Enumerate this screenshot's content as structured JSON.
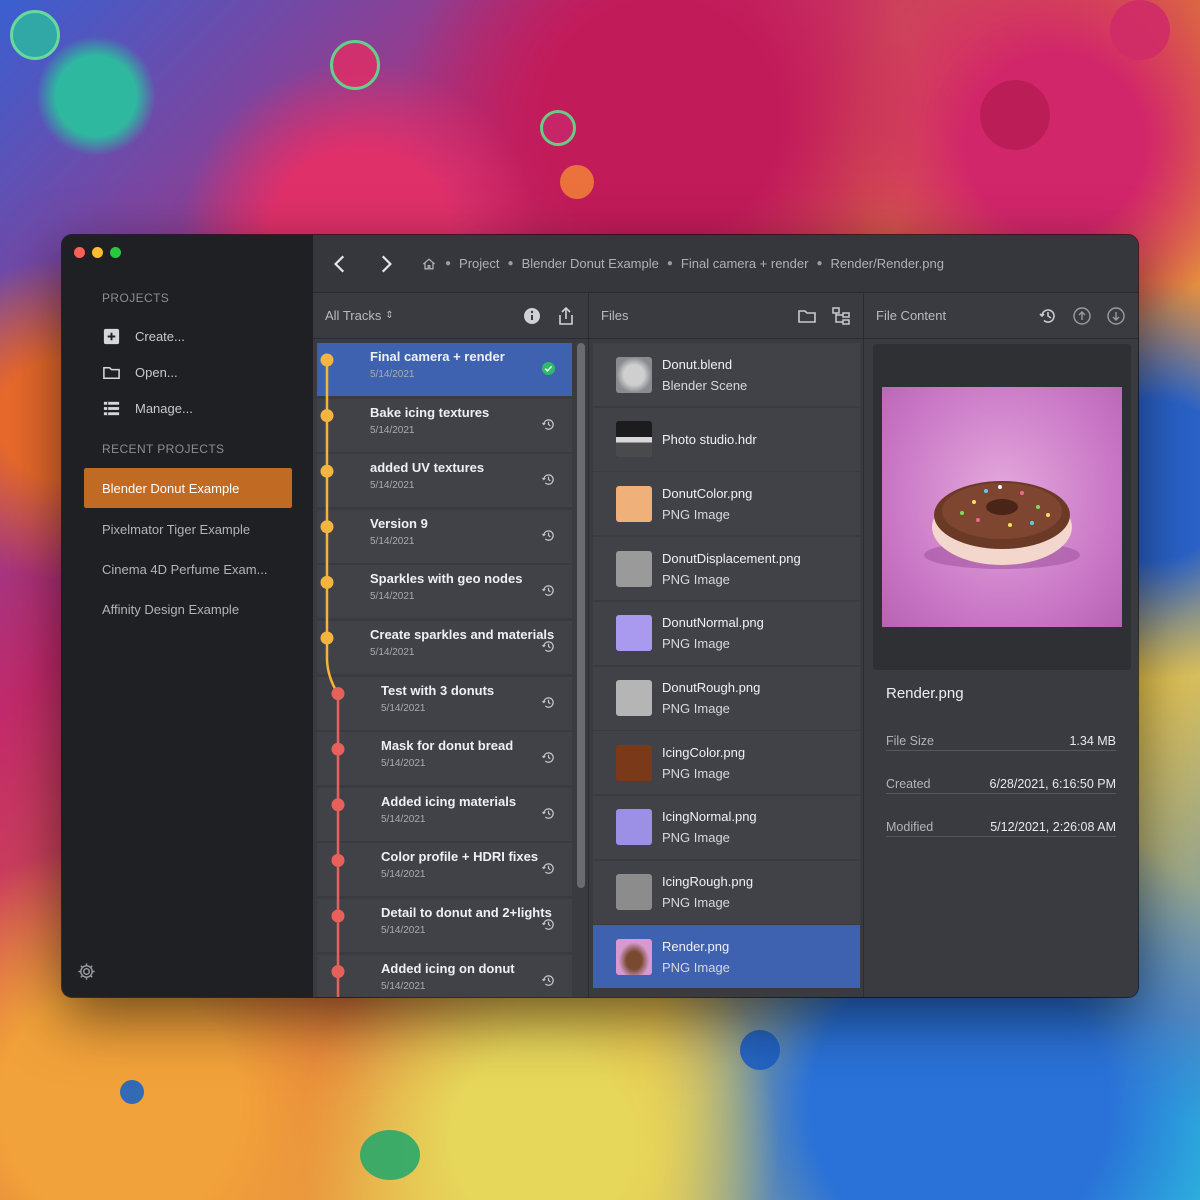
{
  "sidebar": {
    "projects_title": "PROJECTS",
    "actions": [
      {
        "label": "Create...",
        "icon": "plus-square-icon"
      },
      {
        "label": "Open...",
        "icon": "folder-icon"
      },
      {
        "label": "Manage...",
        "icon": "list-icon"
      }
    ],
    "recent_title": "RECENT PROJECTS",
    "recent": [
      {
        "label": "Blender Donut Example",
        "active": true
      },
      {
        "label": "Pixelmator Tiger Example",
        "active": false
      },
      {
        "label": "Cinema 4D Perfume Exam...",
        "active": false
      },
      {
        "label": "Affinity Design Example",
        "active": false
      }
    ],
    "accent": "#c06a24"
  },
  "breadcrumb": [
    "Project",
    "Blender Donut Example",
    "Final camera + render",
    "Render/Render.png"
  ],
  "tracks": {
    "header": "All Tracks",
    "items": [
      {
        "title": "Final camera + render",
        "date": "5/14/2021",
        "branch": "yellow",
        "active": true,
        "icon": "check-circle-icon"
      },
      {
        "title": "Bake icing textures",
        "date": "5/14/2021",
        "branch": "yellow",
        "icon": "history-icon"
      },
      {
        "title": "added UV textures",
        "date": "5/14/2021",
        "branch": "yellow",
        "icon": "history-icon"
      },
      {
        "title": "Version 9",
        "date": "5/14/2021",
        "branch": "yellow",
        "icon": "history-icon"
      },
      {
        "title": "Sparkles with geo nodes",
        "date": "5/14/2021",
        "branch": "yellow",
        "icon": "history-icon"
      },
      {
        "title": "Create sparkles and materials",
        "date": "5/14/2021",
        "branch": "yellow",
        "icon": "history-icon"
      },
      {
        "title": "Test with 3 donuts",
        "date": "5/14/2021",
        "branch": "red",
        "icon": "history-icon"
      },
      {
        "title": "Mask for donut bread",
        "date": "5/14/2021",
        "branch": "red",
        "icon": "history-icon"
      },
      {
        "title": "Added icing materials",
        "date": "5/14/2021",
        "branch": "red",
        "icon": "history-icon"
      },
      {
        "title": "Color profile + HDRI fixes",
        "date": "5/14/2021",
        "branch": "red",
        "icon": "history-icon"
      },
      {
        "title": "Detail to donut and 2+lights",
        "date": "5/14/2021",
        "branch": "red",
        "icon": "history-icon"
      },
      {
        "title": "Added icing on donut",
        "date": "5/14/2021",
        "branch": "red",
        "icon": "history-icon"
      }
    ],
    "colors": {
      "yellow": "#f3b53d",
      "red": "#e8605a",
      "active": "#3f62b0"
    }
  },
  "files": {
    "header": "Files",
    "items": [
      {
        "name": "Donut.blend",
        "type": "Blender Scene",
        "thumb": "#8a8b8f"
      },
      {
        "name": "Photo studio.hdr",
        "type": "",
        "thumb": "#2a2a2c"
      },
      {
        "name": "DonutColor.png",
        "type": "PNG Image",
        "thumb": "#f0b07a"
      },
      {
        "name": "DonutDisplacement.png",
        "type": "PNG Image",
        "thumb": "#9a9a9a"
      },
      {
        "name": "DonutNormal.png",
        "type": "PNG Image",
        "thumb": "#a99af0"
      },
      {
        "name": "DonutRough.png",
        "type": "PNG Image",
        "thumb": "#b5b5b5"
      },
      {
        "name": "IcingColor.png",
        "type": "PNG Image",
        "thumb": "#7a3a1a"
      },
      {
        "name": "IcingNormal.png",
        "type": "PNG Image",
        "thumb": "#9c90e6"
      },
      {
        "name": "IcingRough.png",
        "type": "PNG Image",
        "thumb": "#8c8c8c"
      },
      {
        "name": "Render.png",
        "type": "PNG Image",
        "thumb": "#c98ac6",
        "active": true
      }
    ]
  },
  "content": {
    "header": "File Content",
    "file_name": "Render.png",
    "meta": [
      {
        "key": "File Size",
        "value": "1.34 MB"
      },
      {
        "key": "Created",
        "value": "6/28/2021, 6:16:50 PM"
      },
      {
        "key": "Modified",
        "value": "5/12/2021, 2:26:08 AM"
      }
    ]
  }
}
